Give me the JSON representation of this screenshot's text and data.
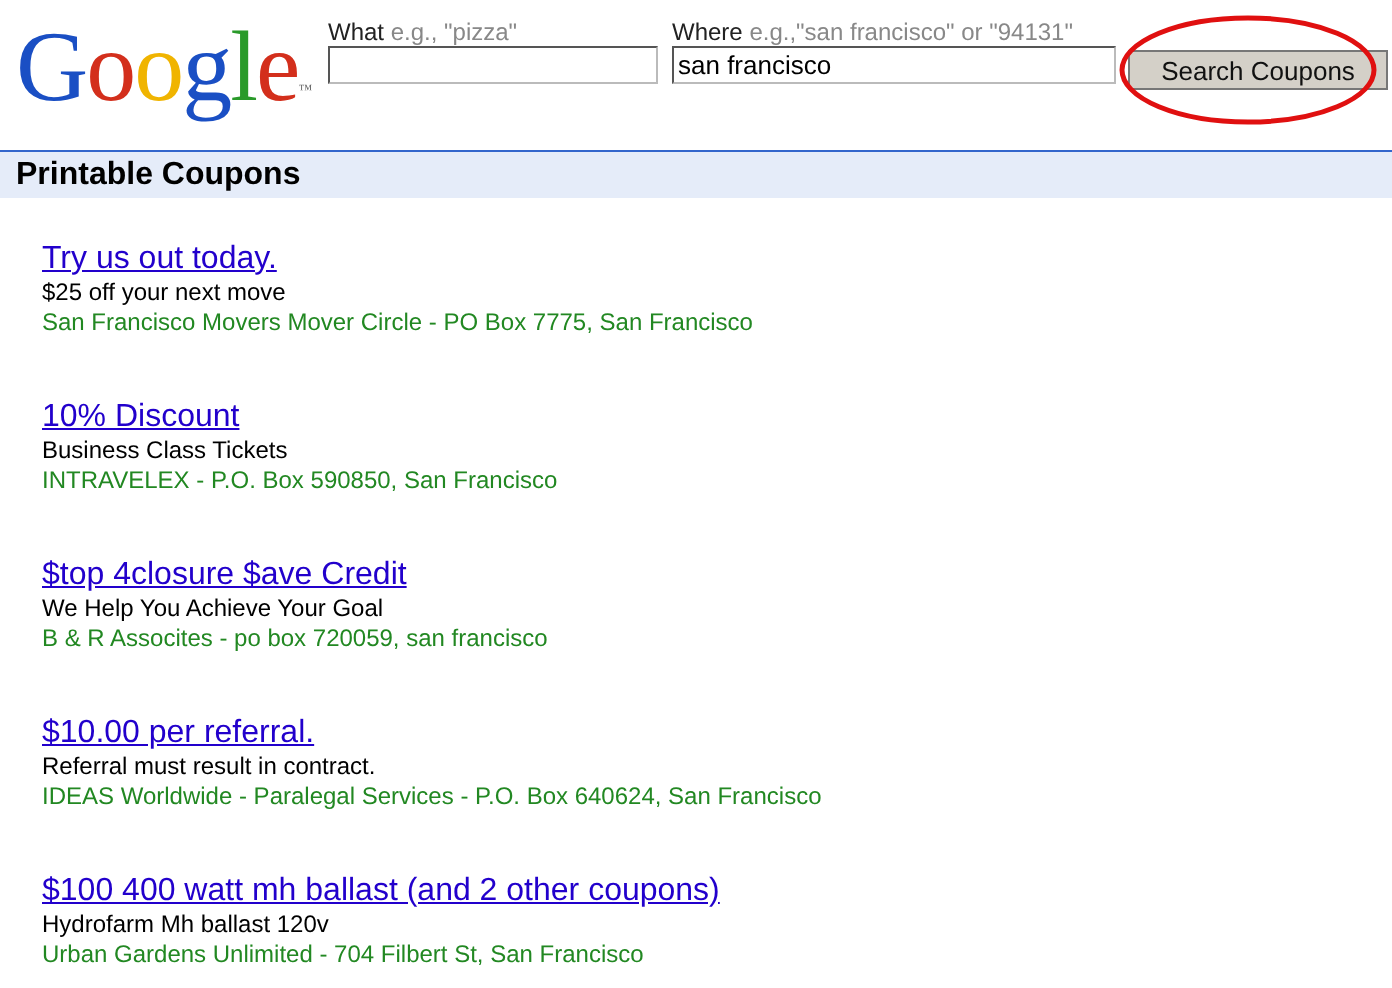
{
  "logo": {
    "text": "Google",
    "trademark": "™"
  },
  "search": {
    "what": {
      "label": "What",
      "hint": "e.g., \"pizza\""
    },
    "where": {
      "label": "Where",
      "hint": "e.g.,\"san francisco\" or \"94131\"",
      "value": "san francisco"
    },
    "button": "Search Coupons",
    "button_circled": true
  },
  "section_title": "Printable Coupons",
  "coupons": [
    {
      "title": "Try us out today.",
      "description": "$25 off your next move",
      "address": "San Francisco Movers Mover Circle - PO Box 7775, San Francisco"
    },
    {
      "title": "10% Discount",
      "description": "Business Class Tickets",
      "address": "INTRAVELEX - P.O. Box 590850, San Francisco"
    },
    {
      "title": "$top 4closure $ave Credit",
      "description": "We Help You Achieve Your Goal",
      "address": "B & R Assocites - po box 720059, san francisco"
    },
    {
      "title": "$10.00 per referral.",
      "description": "Referral must result in contract.",
      "address": "IDEAS Worldwide - Paralegal Services - P.O. Box 640624, San Francisco"
    },
    {
      "title": "$100 400 watt mh ballast (and 2 other coupons)",
      "description": "Hydrofarm Mh ballast 120v",
      "address": "Urban Gardens Unlimited - 704 Filbert St, San Francisco"
    }
  ]
}
